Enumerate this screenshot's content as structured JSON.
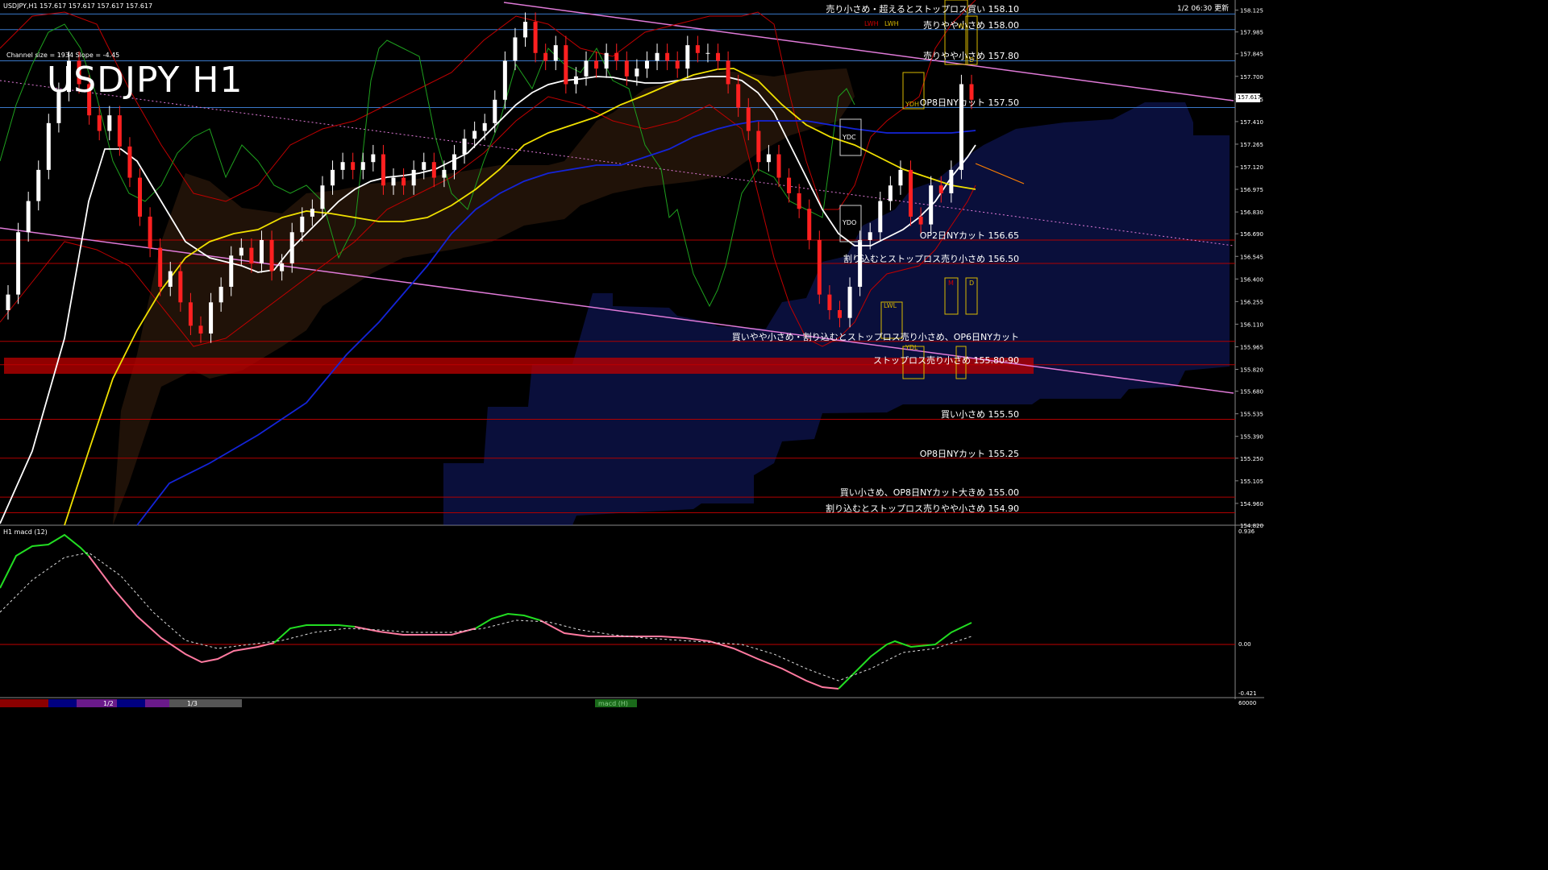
{
  "header": {
    "symbol_info": "USDJPY,H1  157.617 157.617 157.617 157.617",
    "date_label": "1/2 06:30 更新",
    "watermark": "USDJPY H1",
    "channel_info": "Channel size = 1934 Slope = -4.45"
  },
  "macd_panel": {
    "title": "H1  macd (12)",
    "top_label": "0.936",
    "zero_label": "0.00",
    "bottom_label": "-0.421"
  },
  "bottom_bar": {
    "tab_1": "1/2",
    "tab_2": "1/3",
    "indicator_label": "macd (H)",
    "right_value": "60000"
  },
  "chart_data": {
    "type": "candlestick",
    "title": "USDJPY H1",
    "y_axis": {
      "ticks": [
        "158.125",
        "157.985",
        "157.845",
        "157.700",
        "157.555",
        "157.410",
        "157.265",
        "157.120",
        "156.975",
        "156.830",
        "156.690",
        "156.545",
        "156.400",
        "156.255",
        "156.110",
        "155.965",
        "155.820",
        "155.680",
        "155.535",
        "155.390",
        "155.250",
        "155.105",
        "154.960",
        "154.820"
      ],
      "range": [
        154.82,
        158.19
      ],
      "current_price": "157.617"
    },
    "price_levels": [
      {
        "label": "売り小さめ・超えるとストップロス買い 158.10",
        "price": 158.1
      },
      {
        "label": "売りやや小さめ 158.00",
        "price": 158.0
      },
      {
        "label": "売りやや小さめ 157.80",
        "price": 157.8
      },
      {
        "label": "OP8日NYカット 157.50",
        "price": 157.5
      },
      {
        "label": "OP2日NYカット 156.65",
        "price": 156.65
      },
      {
        "label": "割り込むとストップロス売り小さめ 156.50",
        "price": 156.5
      },
      {
        "label": "買いやや小さめ・割り込むとストップロス売り小さめ、OP6日NYカット",
        "price": 156.0
      },
      {
        "label": "ストップロス売り小さめ 155.80-90",
        "price": 155.85
      },
      {
        "label": "買い小さめ 155.50",
        "price": 155.5
      },
      {
        "label": "OP8日NYカット 155.25",
        "price": 155.25
      },
      {
        "label": "買い小さめ、OP8日NYカット大きめ 155.00",
        "price": 155.0
      },
      {
        "label": "割り込むとストップロス売りやや小さめ 154.90",
        "price": 154.9
      }
    ],
    "box_labels": [
      "LWH",
      "LWH",
      "YDH",
      "YDC",
      "YDO",
      "LWL",
      "YDL",
      "M",
      "D",
      "W",
      "D"
    ],
    "series": [
      {
        "name": "close",
        "values": [
          156.3,
          156.7,
          156.9,
          157.1,
          157.4,
          157.6,
          157.8,
          157.65,
          157.45,
          157.35,
          157.45,
          157.25,
          157.05,
          156.8,
          156.6,
          156.35,
          156.45,
          156.25,
          156.1,
          156.05,
          156.25,
          156.35,
          156.55,
          156.6,
          156.5,
          156.65,
          156.45,
          156.5,
          156.7,
          156.8,
          156.85,
          157.0,
          157.1,
          157.15,
          157.1,
          157.15,
          157.2,
          157.0,
          157.05,
          157.0,
          157.1,
          157.15,
          157.05,
          157.1,
          157.2,
          157.3,
          157.35,
          157.4,
          157.55,
          157.8,
          157.95,
          158.05,
          157.85,
          157.8,
          157.9,
          157.65,
          157.7,
          157.8,
          157.75,
          157.85,
          157.8,
          157.7,
          157.75,
          157.8,
          157.85,
          157.8,
          157.75,
          157.9,
          157.85,
          157.85,
          157.8,
          157.65,
          157.5,
          157.35,
          157.15,
          157.2,
          157.05,
          156.95,
          156.85,
          156.65,
          156.3,
          156.2,
          156.15,
          156.35,
          156.65,
          156.7,
          156.9,
          157.0,
          157.1,
          156.8,
          156.75,
          157.0,
          156.95,
          157.1,
          157.65,
          157.55
        ]
      }
    ]
  }
}
